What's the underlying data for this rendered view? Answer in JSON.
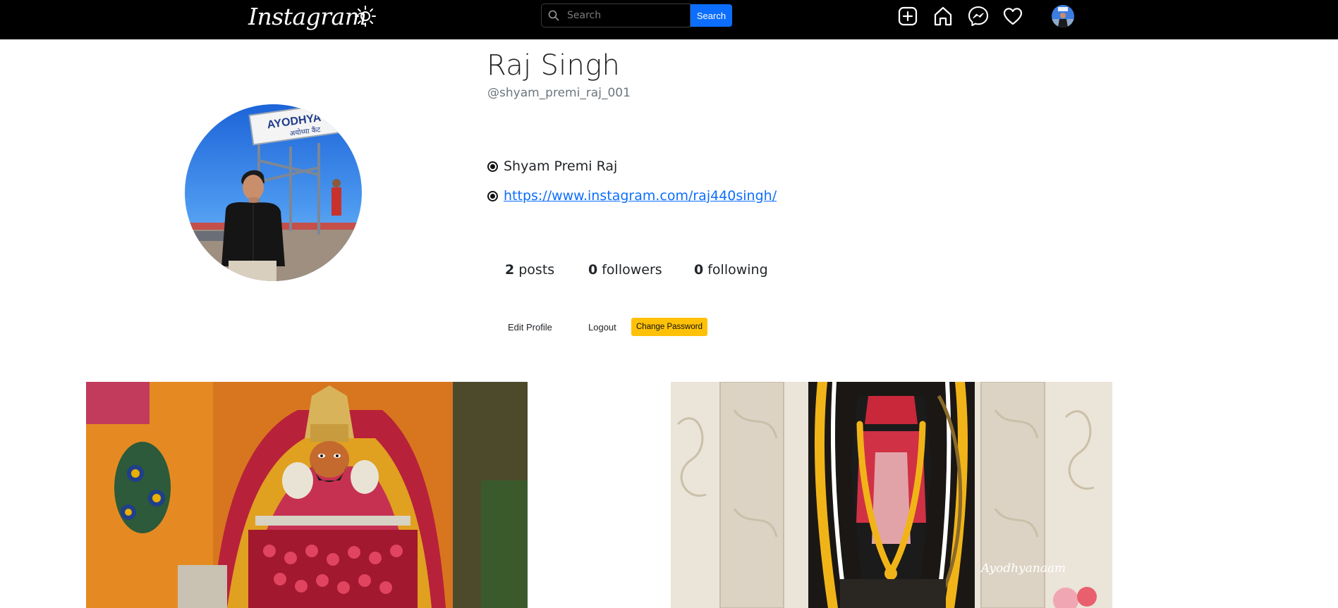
{
  "nav": {
    "logo": "Instagram",
    "search_placeholder": "Search",
    "search_button": "Search"
  },
  "profile": {
    "full_name": "Raj Singh",
    "username": "@shyam_premi_raj_001",
    "bio_name": "Shyam Premi Raj",
    "bio_link": "https://www.instagram.com/raj440singh/",
    "profile_pic_sign_text": "AYODHYA CA",
    "profile_pic_sign_subtext": "अयोध्या कैंट"
  },
  "stats": {
    "posts_count": "2",
    "posts_label": "posts",
    "followers_count": "0",
    "followers_label": "followers",
    "following_count": "0",
    "following_label": "following"
  },
  "actions": {
    "edit_profile": "Edit Profile",
    "logout": "Logout",
    "change_password": "Change Password"
  },
  "posts": [
    {
      "watermark": ""
    },
    {
      "watermark": "Ayodhyanaam"
    }
  ],
  "colors": {
    "navbar_bg": "#000000",
    "search_button": "#0d6efd",
    "change_password_button": "#ffc107",
    "link": "#0d6efd"
  }
}
